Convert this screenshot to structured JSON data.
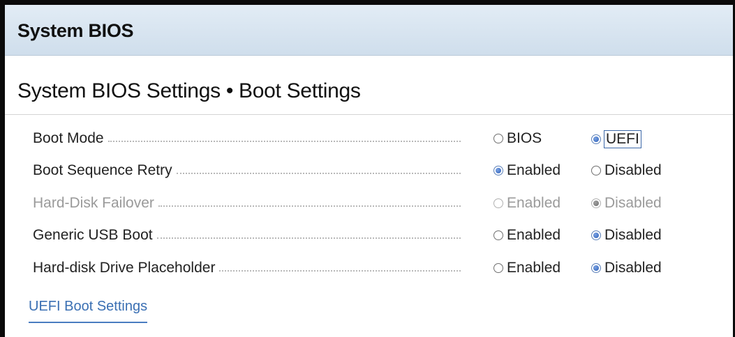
{
  "header": {
    "title": "System BIOS"
  },
  "page": {
    "title": "System BIOS Settings • Boot Settings"
  },
  "settings": [
    {
      "label": "Boot Mode",
      "disabled": false,
      "options": [
        {
          "label": "BIOS",
          "checked": false
        },
        {
          "label": "UEFI",
          "checked": true,
          "focused": true
        }
      ]
    },
    {
      "label": "Boot Sequence Retry",
      "disabled": false,
      "options": [
        {
          "label": "Enabled",
          "checked": true
        },
        {
          "label": "Disabled",
          "checked": false
        }
      ]
    },
    {
      "label": "Hard-Disk Failover",
      "disabled": true,
      "options": [
        {
          "label": "Enabled",
          "checked": false
        },
        {
          "label": "Disabled",
          "checked": true
        }
      ]
    },
    {
      "label": "Generic USB Boot",
      "disabled": false,
      "options": [
        {
          "label": "Enabled",
          "checked": false
        },
        {
          "label": "Disabled",
          "checked": true
        }
      ]
    },
    {
      "label": "Hard-disk Drive Placeholder",
      "disabled": false,
      "options": [
        {
          "label": "Enabled",
          "checked": false
        },
        {
          "label": "Disabled",
          "checked": true
        }
      ]
    }
  ],
  "links": {
    "uefi_boot_settings": "UEFI Boot Settings"
  },
  "colors": {
    "accent": "#3a6fb3",
    "header_bg": "#d8e5f1",
    "disabled_text": "#9a9a9a"
  }
}
